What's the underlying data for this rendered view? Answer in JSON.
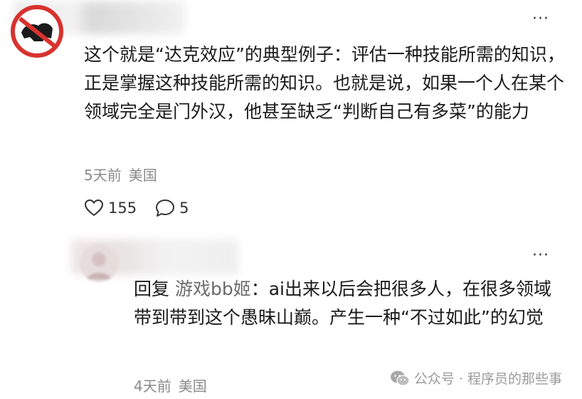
{
  "comments": [
    {
      "text": "这个就是“达克效应”的典型例子：评估一种技能所需的知识，正是掌握这种技能所需的知识。也就是说，如果一个人在某个领域完全是门外汉，他甚至缺乏“判断自己有多菜”的能力",
      "time": "5天前",
      "location": "美国",
      "likes": "155",
      "replies": "5",
      "more": "···"
    },
    {
      "reply_prefix": "回复",
      "reply_to": "游戏bb姬",
      "separator": "：",
      "text": "ai出来以后会把很多人，在很多领域带到带到这个愚昧山巅。产生一种“不过如此”的幻觉",
      "time": "4天前",
      "location": "美国",
      "more": "···"
    }
  ],
  "watermark": {
    "text": "公众号 · 程序员的那些事",
    "icon": "wechat-icon"
  },
  "colors": {
    "text": "#1a1a1a",
    "meta": "#8a8a8a",
    "reply_name": "#6b6b6b",
    "avatar_red": "#d8322e"
  }
}
